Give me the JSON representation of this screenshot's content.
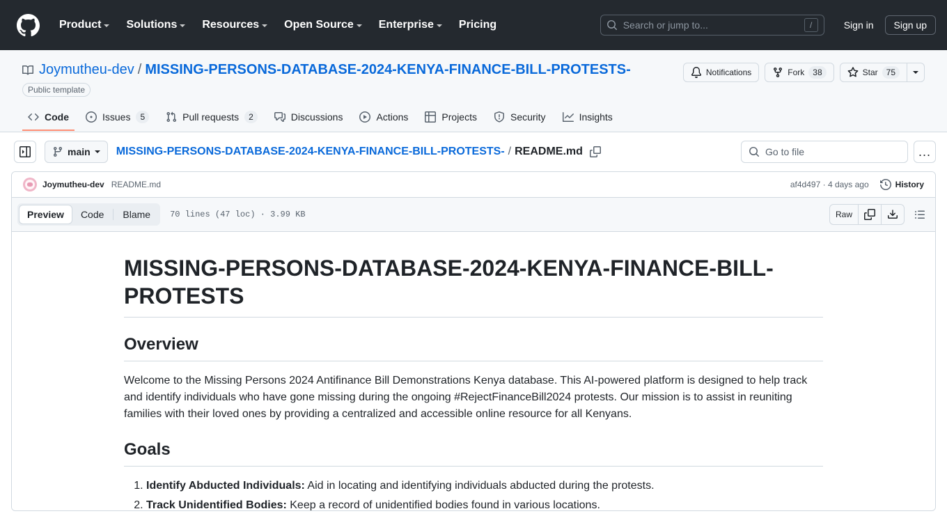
{
  "global_header": {
    "logo_icon": "github-mark-icon",
    "nav": [
      {
        "label": "Product",
        "has_caret": true
      },
      {
        "label": "Solutions",
        "has_caret": true
      },
      {
        "label": "Resources",
        "has_caret": true
      },
      {
        "label": "Open Source",
        "has_caret": true
      },
      {
        "label": "Enterprise",
        "has_caret": true
      },
      {
        "label": "Pricing",
        "has_caret": false
      }
    ],
    "search": {
      "placeholder": "Search or jump to...",
      "shortcut": "/",
      "icon": "search-icon"
    },
    "sign_in": "Sign in",
    "sign_up": "Sign up"
  },
  "repo": {
    "owner": "Joymutheu-dev",
    "separator": "/",
    "name": "MISSING-PERSONS-DATABASE-2024-KENYA-FINANCE-BILL-PROTESTS-",
    "visibility_badge": "Public template",
    "repo_icon": "repo-template-icon",
    "actions": {
      "notifications": {
        "label": "Notifications",
        "icon": "bell-icon"
      },
      "fork": {
        "label": "Fork",
        "count": "38",
        "icon": "fork-icon"
      },
      "star": {
        "label": "Star",
        "count": "75",
        "icon": "star-icon"
      },
      "star_dropdown_icon": "triangle-down-icon"
    },
    "tabs": [
      {
        "label": "Code",
        "icon": "code-icon",
        "count": null,
        "active": true
      },
      {
        "label": "Issues",
        "icon": "issue-opened-icon",
        "count": "5",
        "active": false
      },
      {
        "label": "Pull requests",
        "icon": "git-pull-request-icon",
        "count": "2",
        "active": false
      },
      {
        "label": "Discussions",
        "icon": "comment-discussion-icon",
        "count": null,
        "active": false
      },
      {
        "label": "Actions",
        "icon": "play-icon",
        "count": null,
        "active": false
      },
      {
        "label": "Projects",
        "icon": "table-icon",
        "count": null,
        "active": false
      },
      {
        "label": "Security",
        "icon": "shield-icon",
        "count": null,
        "active": false
      },
      {
        "label": "Insights",
        "icon": "graph-icon",
        "count": null,
        "active": false
      }
    ]
  },
  "file_nav": {
    "sidebar_toggle_icon": "sidebar-expand-icon",
    "branch": {
      "name": "main",
      "icon": "git-branch-icon",
      "caret_icon": "triangle-down-icon"
    },
    "breadcrumb": {
      "repo": "MISSING-PERSONS-DATABASE-2024-KENYA-FINANCE-BILL-PROTESTS-",
      "separator": "/",
      "file": "README.md",
      "copy_icon": "copy-path-icon"
    },
    "go_to_file": {
      "placeholder": "Go to file",
      "icon": "search-icon"
    },
    "more_icon": "kebab-horizontal-icon",
    "more_label": "..."
  },
  "commit_bar": {
    "avatar": "user-avatar",
    "author": "Joymutheu-dev",
    "message": "README.md",
    "sha": "af4d497",
    "dot": "·",
    "relative_time": "4 days ago",
    "history_label": "History",
    "history_icon": "history-icon"
  },
  "view_bar": {
    "views": [
      {
        "label": "Preview",
        "active": true
      },
      {
        "label": "Code",
        "active": false
      },
      {
        "label": "Blame",
        "active": false
      }
    ],
    "file_meta": "70 lines (47 loc) · 3.99 KB",
    "raw_label": "Raw",
    "copy_icon": "copy-icon",
    "download_icon": "download-icon",
    "outline_icon": "list-unordered-icon"
  },
  "readme": {
    "h1": "MISSING-PERSONS-DATABASE-2024-KENYA-FINANCE-BILL-PROTESTS",
    "overview_heading": "Overview",
    "overview_paragraph": "Welcome to the Missing Persons 2024 Antifinance Bill Demonstrations Kenya database. This AI-powered platform is designed to help track and identify individuals who have gone missing during the ongoing #RejectFinanceBill2024 protests. Our mission is to assist in reuniting families with their loved ones by providing a centralized and accessible online resource for all Kenyans.",
    "goals_heading": "Goals",
    "goals": [
      {
        "term": "Identify Abducted Individuals:",
        "desc": " Aid in locating and identifying individuals abducted during the protests."
      },
      {
        "term": "Track Unidentified Bodies:",
        "desc": " Keep a record of unidentified bodies found in various locations."
      }
    ]
  },
  "colors": {
    "header_bg": "#24292f",
    "link": "#0969da",
    "active_tab_underline": "#fd8c73",
    "border": "#d1d9e0",
    "muted_text": "#59636e",
    "subtle_bg": "#f6f8fa"
  }
}
